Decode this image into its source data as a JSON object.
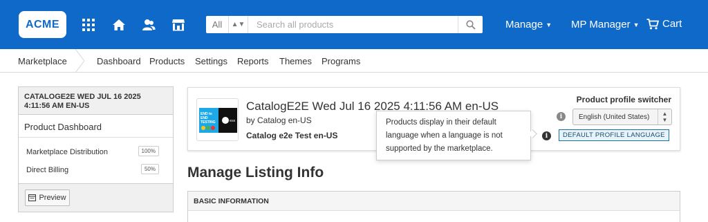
{
  "header": {
    "logo": "ACME",
    "search": {
      "scope": "All",
      "placeholder": "Search all products"
    },
    "menus": {
      "manage": "Manage",
      "mp_manager": "MP Manager",
      "cart": "Cart"
    },
    "colors": {
      "brand": "#0e69c8"
    }
  },
  "subnav": {
    "breadcrumb": "Marketplace",
    "items": [
      "Dashboard",
      "Products",
      "Settings",
      "Reports",
      "Themes",
      "Programs"
    ]
  },
  "sidebar": {
    "catalog_heading": "CATALOGE2E WED JUL 16 2025 4:11:56 AM EN-US",
    "dashboard_label": "Product Dashboard",
    "rows": [
      {
        "label": "Marketplace Distribution",
        "value": "100%"
      },
      {
        "label": "Direct Billing",
        "value": "50%"
      }
    ],
    "preview_label": "Preview"
  },
  "product": {
    "thumb_text": "END to END TESTING",
    "title": "CatalogE2E Wed Jul 16 2025 4:11:56 AM en-US",
    "by": "by Catalog en-US",
    "subtitle": "Catalog e2e Test en-US",
    "switcher_title": "Product profile switcher",
    "language_selected": "English (United States)",
    "default_badge": "DEFAULT PROFILE LANGUAGE"
  },
  "tooltip": {
    "text": "Products display in their default language when a language is not supported by the marketplace."
  },
  "main": {
    "section_title": "Manage Listing Info",
    "basic_info_heading": "BASIC INFORMATION"
  }
}
